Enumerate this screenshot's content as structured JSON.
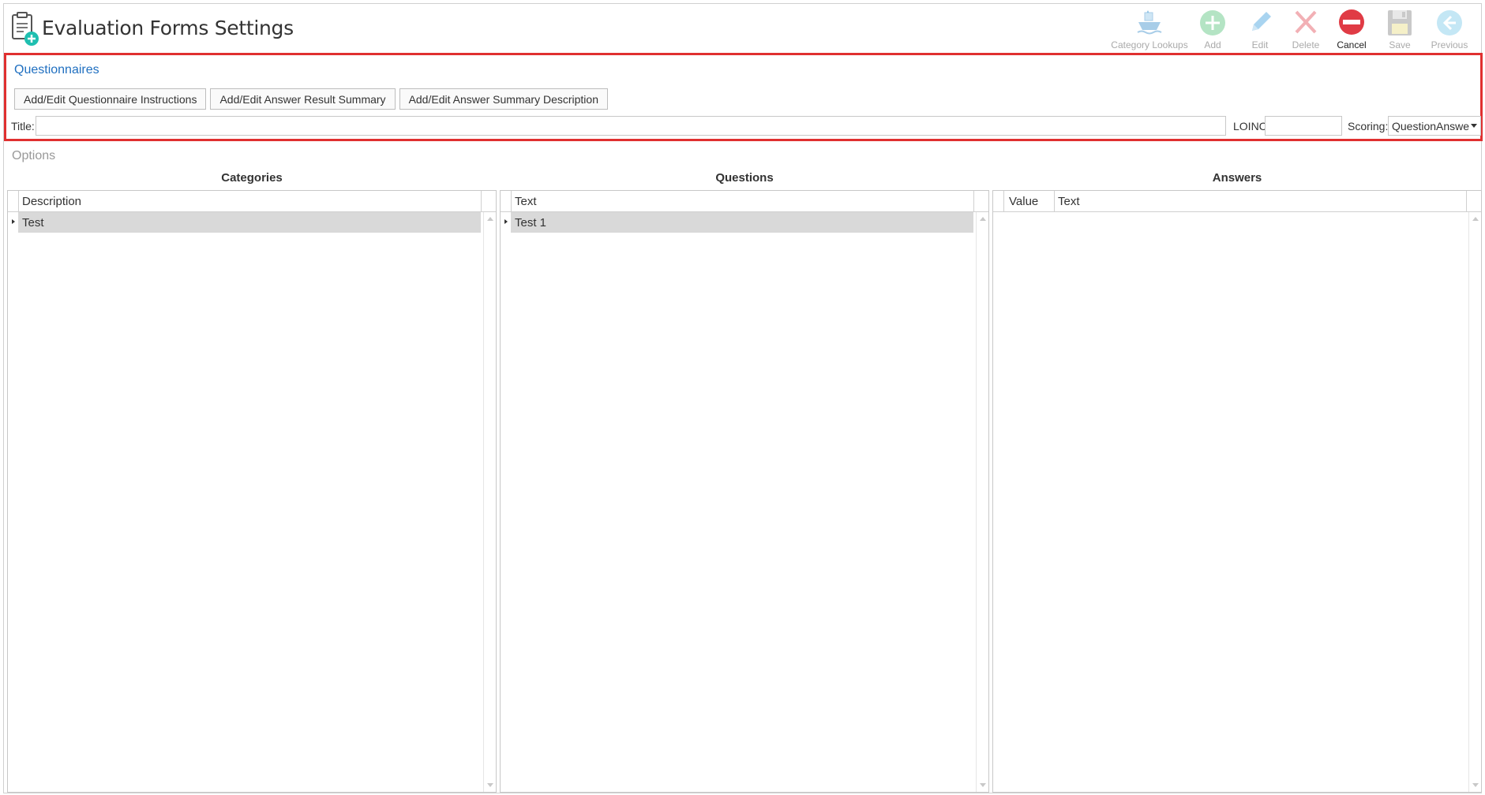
{
  "header": {
    "title": "Evaluation Forms Settings",
    "icon": "clipboard-add-icon"
  },
  "toolbar": {
    "items": [
      {
        "label": "Category Lookups",
        "icon": "boat-icon",
        "enabled": false
      },
      {
        "label": "Add",
        "icon": "plus-circle-icon",
        "enabled": false
      },
      {
        "label": "Edit",
        "icon": "pencil-icon",
        "enabled": false
      },
      {
        "label": "Delete",
        "icon": "x-icon",
        "enabled": false
      },
      {
        "label": "Cancel",
        "icon": "no-entry-icon",
        "enabled": true
      },
      {
        "label": "Save",
        "icon": "floppy-disk-icon",
        "enabled": false
      },
      {
        "label": "Previous",
        "icon": "arrow-left-circle-icon",
        "enabled": false
      }
    ]
  },
  "questionnaires": {
    "title": "Questionnaires",
    "buttons": {
      "instructions": "Add/Edit Questionnaire Instructions",
      "result_summary": "Add/Edit Answer Result Summary",
      "summary_description": "Add/Edit Answer Summary Description"
    },
    "title_label": "Title:",
    "title_value": "",
    "loinc_label": "LOINC",
    "loinc_value": "",
    "scoring_label": "Scoring:",
    "scoring_value": "QuestionAnswe"
  },
  "options": {
    "title": "Options",
    "categories": {
      "heading": "Categories",
      "columns": [
        "Description"
      ],
      "rows": [
        [
          "Test"
        ]
      ]
    },
    "questions": {
      "heading": "Questions",
      "columns": [
        "Text"
      ],
      "rows": [
        [
          "Test 1"
        ]
      ]
    },
    "answers": {
      "heading": "Answers",
      "columns": [
        "Value",
        "Text"
      ],
      "rows": []
    }
  },
  "colors": {
    "accent": "#1f6fc0",
    "highlight_border": "#e03030",
    "cancel": "#e03b45",
    "selected_row": "#d9d9d9"
  }
}
